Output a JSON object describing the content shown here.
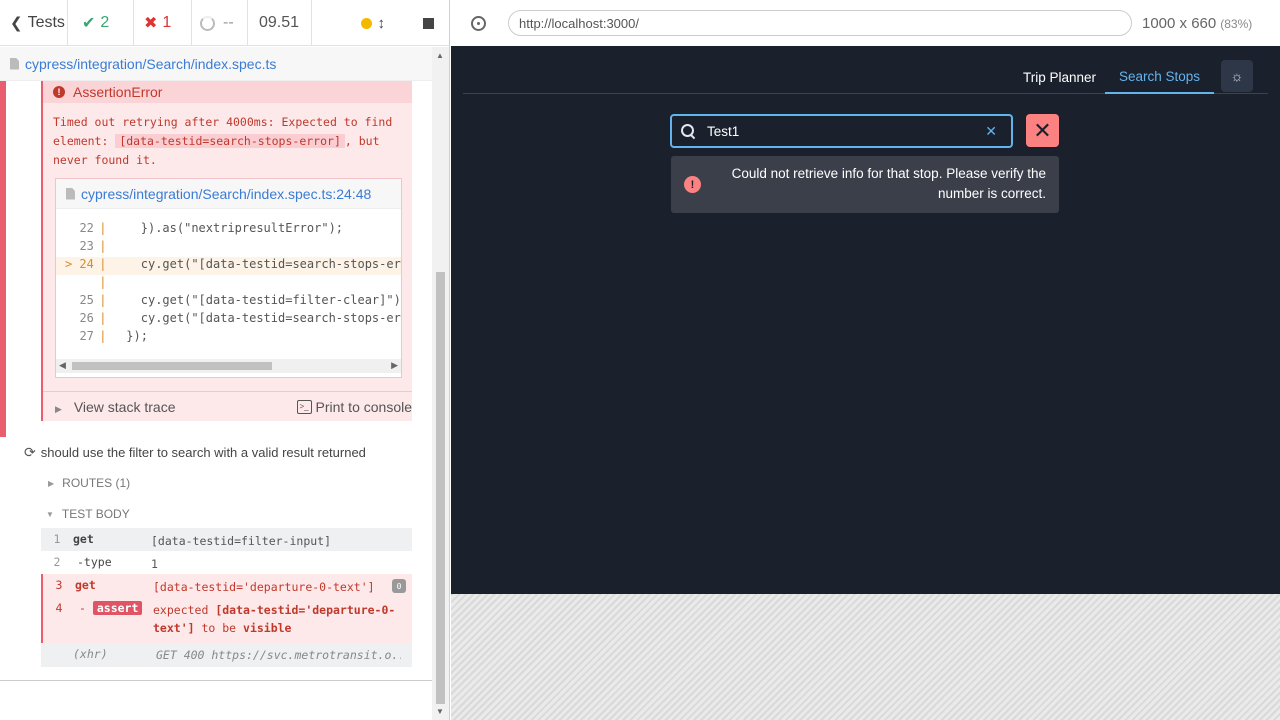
{
  "reporter": {
    "tests_label": "Tests",
    "passed": "2",
    "failed": "1",
    "pending": "--",
    "duration": "09.51",
    "spec_path": "cypress/integration/Search/index.spec.ts",
    "error": {
      "title": "AssertionError",
      "msg_before": "Timed out retrying after 4000ms: Expected to find element: ",
      "msg_code": "[data-testid=search-stops-error]",
      "msg_after": ", but never found it.",
      "frame_path": "cypress/integration/Search/index.spec.ts:24:48",
      "lines": [
        {
          "n": "22",
          "bar": "|",
          "code": "    }).as(\"nextripresultError\");"
        },
        {
          "n": "23",
          "bar": "|",
          "code": ""
        },
        {
          "n": "> 24",
          "bar": "|",
          "code": "    cy.get(\"[data-testid=search-stops-error]\")"
        },
        {
          "n": "",
          "bar": "|",
          "code": ""
        },
        {
          "n": "25",
          "bar": "|",
          "code": "    cy.get(\"[data-testid=filter-clear]\").click();"
        },
        {
          "n": "26",
          "bar": "|",
          "code": "    cy.get(\"[data-testid=search-stops-error]\")"
        },
        {
          "n": "27",
          "bar": "|",
          "code": "  });"
        }
      ],
      "view_stack": "View stack trace",
      "print_console": "Print to console"
    },
    "test2_title": "should use the filter to search with a valid result returned",
    "routes_label": "ROUTES (1)",
    "body_label": "TEST BODY",
    "commands": [
      {
        "num": "1",
        "name": "get",
        "msg": "[data-testid=filter-input]"
      },
      {
        "num": "2",
        "name": "-type",
        "msg": "1"
      },
      {
        "num": "3",
        "name": "get",
        "msg": "[data-testid='departure-0-text']"
      },
      {
        "num": "4",
        "name": "assert",
        "msg_pre": "expected ",
        "msg_sel": "[data-testid='departure-0-text']",
        "msg_mid": " to be ",
        "msg_val": "visible"
      }
    ],
    "pin_count": "0",
    "xhr": {
      "label": "(xhr)",
      "msg": "GET 400 https://svc.metrotransit.o..."
    }
  },
  "aut_header": {
    "url": "http://localhost:3000/",
    "size": "1000 x 660",
    "scale": "(83%)"
  },
  "app": {
    "tabs": [
      "Trip Planner",
      "Search Stops"
    ],
    "search_value": "Test1",
    "alert": "Could not retrieve info for that stop. Please verify the number is correct."
  },
  "colors": {
    "fail": "#e95e6f",
    "pass": "#3aa674",
    "app_bg": "#1a202c",
    "accent": "#63b3ed",
    "danger": "#fc8181"
  }
}
